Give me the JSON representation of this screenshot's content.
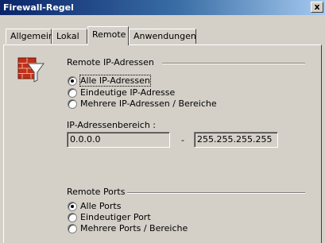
{
  "window": {
    "title": "Firewall-Regel",
    "close_label": "x"
  },
  "tabs": [
    {
      "label": "Allgemein",
      "active": false
    },
    {
      "label": "Lokal",
      "active": false
    },
    {
      "label": "Remote",
      "active": true
    },
    {
      "label": "Anwendungen",
      "active": false
    }
  ],
  "remote_ip": {
    "group_label": "Remote IP-Adressen",
    "options": [
      {
        "label": "Alle IP-Adressen",
        "selected": true
      },
      {
        "label": "Eindeutige IP-Adresse",
        "selected": false
      },
      {
        "label": "Mehrere IP-Adressen / Bereiche",
        "selected": false
      }
    ],
    "range_label": "IP-Adressenbereich :",
    "range_from": "0.0.0.0",
    "range_separator": "-",
    "range_to": "255.255.255.255"
  },
  "remote_ports": {
    "group_label": "Remote Ports",
    "options": [
      {
        "label": "Alle Ports",
        "selected": true
      },
      {
        "label": "Eindeutiger Port",
        "selected": false
      },
      {
        "label": "Mehrere Ports / Bereiche",
        "selected": false
      }
    ]
  },
  "icons": {
    "rule_icon": "firewall-rule-icon"
  }
}
